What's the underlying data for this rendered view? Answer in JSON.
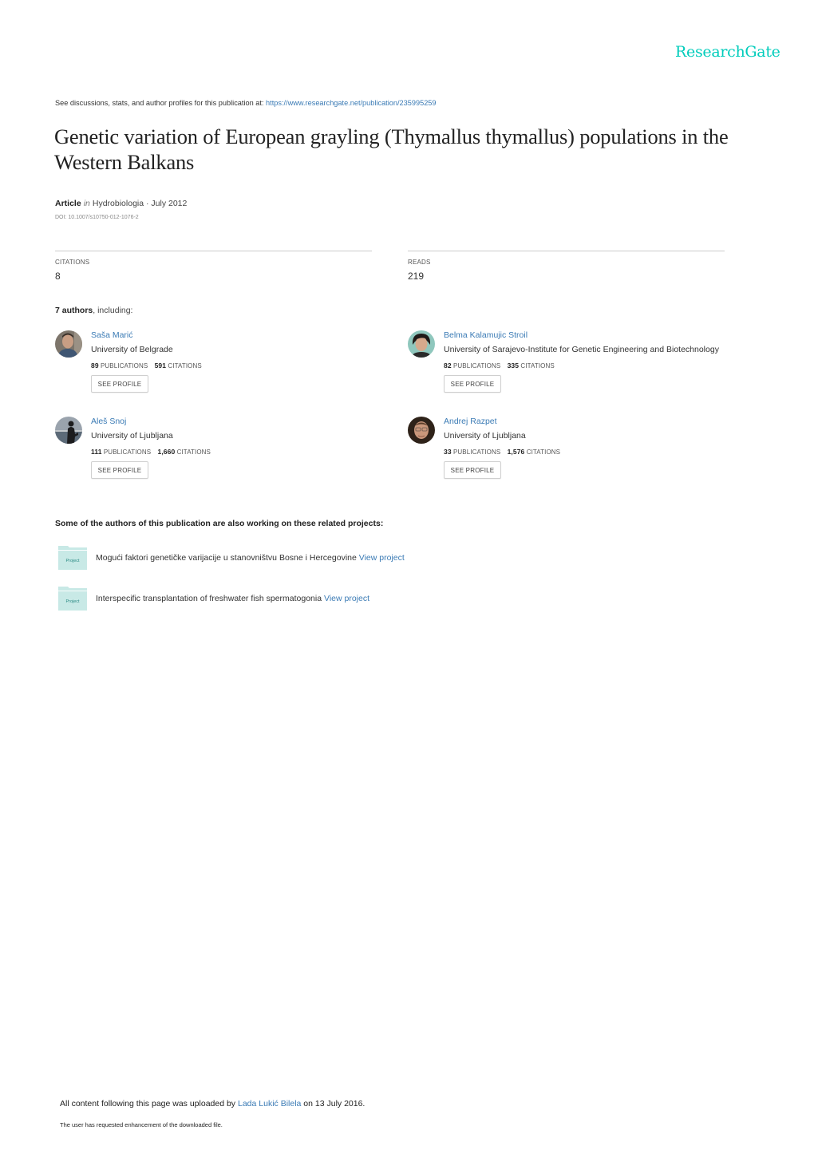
{
  "brand": {
    "logo_text": "ResearchGate",
    "accent_color": "#00ccbb",
    "link_color": "#3b7bb5"
  },
  "header": {
    "see_text": "See discussions, stats, and author profiles for this publication at: ",
    "url": "https://www.researchgate.net/publication/235995259"
  },
  "publication": {
    "title": "Genetic variation of European grayling (Thymallus thymallus) populations in the Western Balkans",
    "type": "Article",
    "in_word": "in",
    "journal_date": "Hydrobiologia · July 2012",
    "doi": "DOI: 10.1007/s10750-012-1076-2"
  },
  "stats": {
    "citations_label": "CITATIONS",
    "citations_value": "8",
    "reads_label": "READS",
    "reads_value": "219"
  },
  "authors_section": {
    "count_text": "7 authors",
    "suffix": ", including:",
    "see_profile_label": "SEE PROFILE",
    "publications_label": "PUBLICATIONS",
    "citations_label": "CITATIONS",
    "authors": [
      {
        "name": "Saša Marić",
        "institution": "University of Belgrade",
        "publications": "89",
        "citations": "591"
      },
      {
        "name": "Belma Kalamujic Stroil",
        "institution": "University of Sarajevo-Institute for Genetic Engineering and Biotechnology",
        "publications": "82",
        "citations": "335"
      },
      {
        "name": "Aleš Snoj",
        "institution": "University of Ljubljana",
        "publications": "111",
        "citations": "1,660"
      },
      {
        "name": "Andrej Razpet",
        "institution": "University of Ljubljana",
        "publications": "33",
        "citations": "1,576"
      }
    ]
  },
  "projects_section": {
    "heading": "Some of the authors of this publication are also working on these related projects:",
    "icon_label": "Project",
    "view_label": "View project",
    "projects": [
      {
        "title": "Mogući faktori genetičke varijacije u stanovništvu Bosne i Hercegovine"
      },
      {
        "title": "Interspecific transplantation of freshwater fish spermatogonia"
      }
    ]
  },
  "footer": {
    "uploaded_prefix": "All content following this page was uploaded by ",
    "uploader": "Lada Lukić Bilela",
    "uploaded_suffix": " on 13 July 2016.",
    "note": "The user has requested enhancement of the downloaded file."
  }
}
